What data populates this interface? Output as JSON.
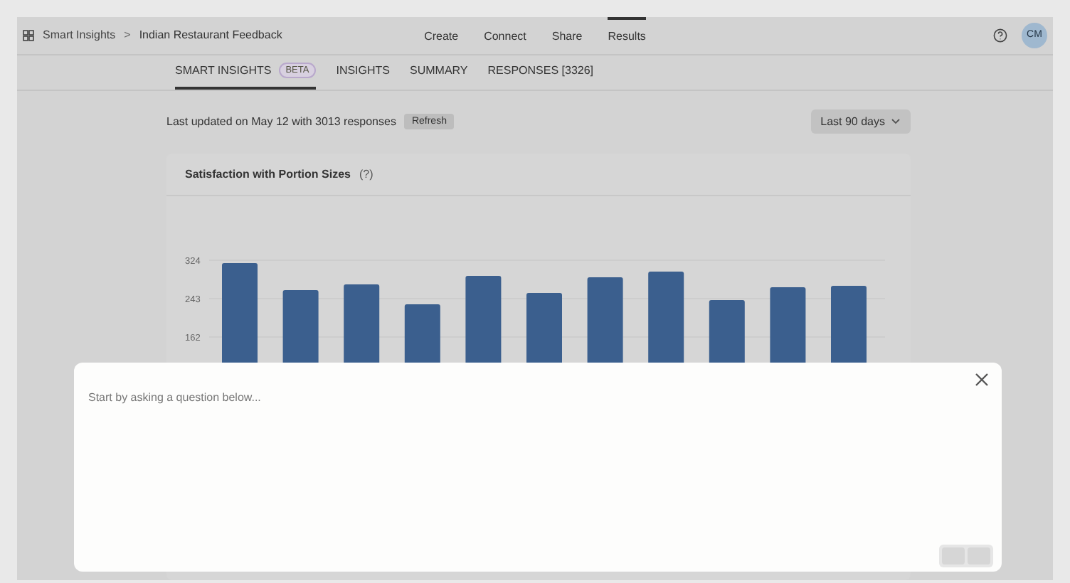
{
  "breadcrumb": {
    "app": "Smart Insights",
    "separator": ">",
    "survey": "Indian Restaurant Feedback"
  },
  "nav": [
    {
      "label": "Create",
      "selected": false
    },
    {
      "label": "Connect",
      "selected": false
    },
    {
      "label": "Share",
      "selected": false
    },
    {
      "label": "Results",
      "selected": true
    }
  ],
  "user": {
    "initials": "CM"
  },
  "tabs": [
    {
      "label": "SMART INSIGHTS",
      "badge": "BETA",
      "selected": true
    },
    {
      "label": "INSIGHTS",
      "selected": false
    },
    {
      "label": "SUMMARY",
      "selected": false
    },
    {
      "label": "RESPONSES [3326]",
      "selected": false
    }
  ],
  "status": {
    "text": "Last updated on May 12 with 3013 responses",
    "refresh": "Refresh",
    "range": "Last 90 days"
  },
  "card": {
    "title": "Satisfaction with Portion Sizes",
    "help": "(?)",
    "chart_data": {
      "type": "bar",
      "ylim": [
        0,
        324
      ],
      "grid": true,
      "yticks": [
        162,
        243,
        324
      ],
      "values": [
        318,
        261,
        273,
        231,
        291,
        255,
        288,
        300,
        240,
        267,
        270
      ]
    }
  },
  "dialog": {
    "prompt": "Start by asking a question below..."
  }
}
